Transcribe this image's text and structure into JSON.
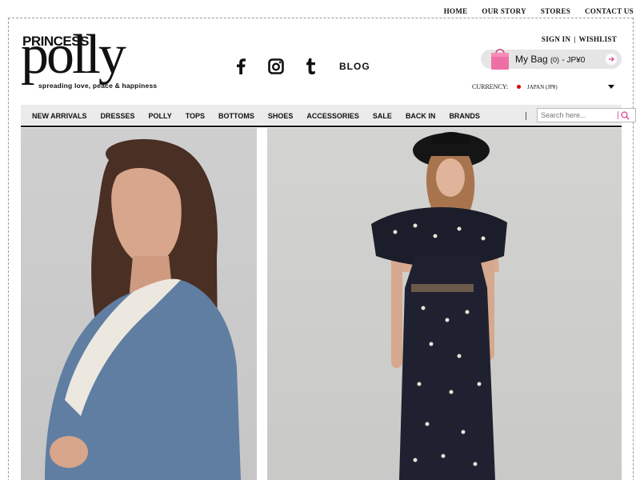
{
  "top_nav": [
    "HOME",
    "OUR STORY",
    "STORES",
    "CONTACT US"
  ],
  "logo": {
    "princess": "PRINCESS",
    "polly": "polly",
    "tagline": "spreading love, peace & happiness"
  },
  "social": {
    "icons": [
      "facebook-icon",
      "instagram-icon",
      "tumblr-icon"
    ],
    "blog_label": "BLOG"
  },
  "account": {
    "sign_in": "SIGN IN",
    "separator": "|",
    "wishlist": "WISHLIST"
  },
  "bag": {
    "label": "My Bag",
    "count": "(0)",
    "amount": "- JP¥0",
    "color": "#ee6fa6"
  },
  "currency": {
    "label": "CURRENCY:",
    "value": "JAPAN (JP¥)"
  },
  "main_nav": [
    "NEW ARRIVALS",
    "DRESSES",
    "POLLY",
    "TOPS",
    "BOTTOMS",
    "SHOES",
    "ACCESSORIES",
    "SALE",
    "BACK IN",
    "BRANDS"
  ],
  "search": {
    "placeholder": "Search here..."
  },
  "colors": {
    "accent": "#e3478f",
    "nav_bg": "#ebebeb"
  }
}
